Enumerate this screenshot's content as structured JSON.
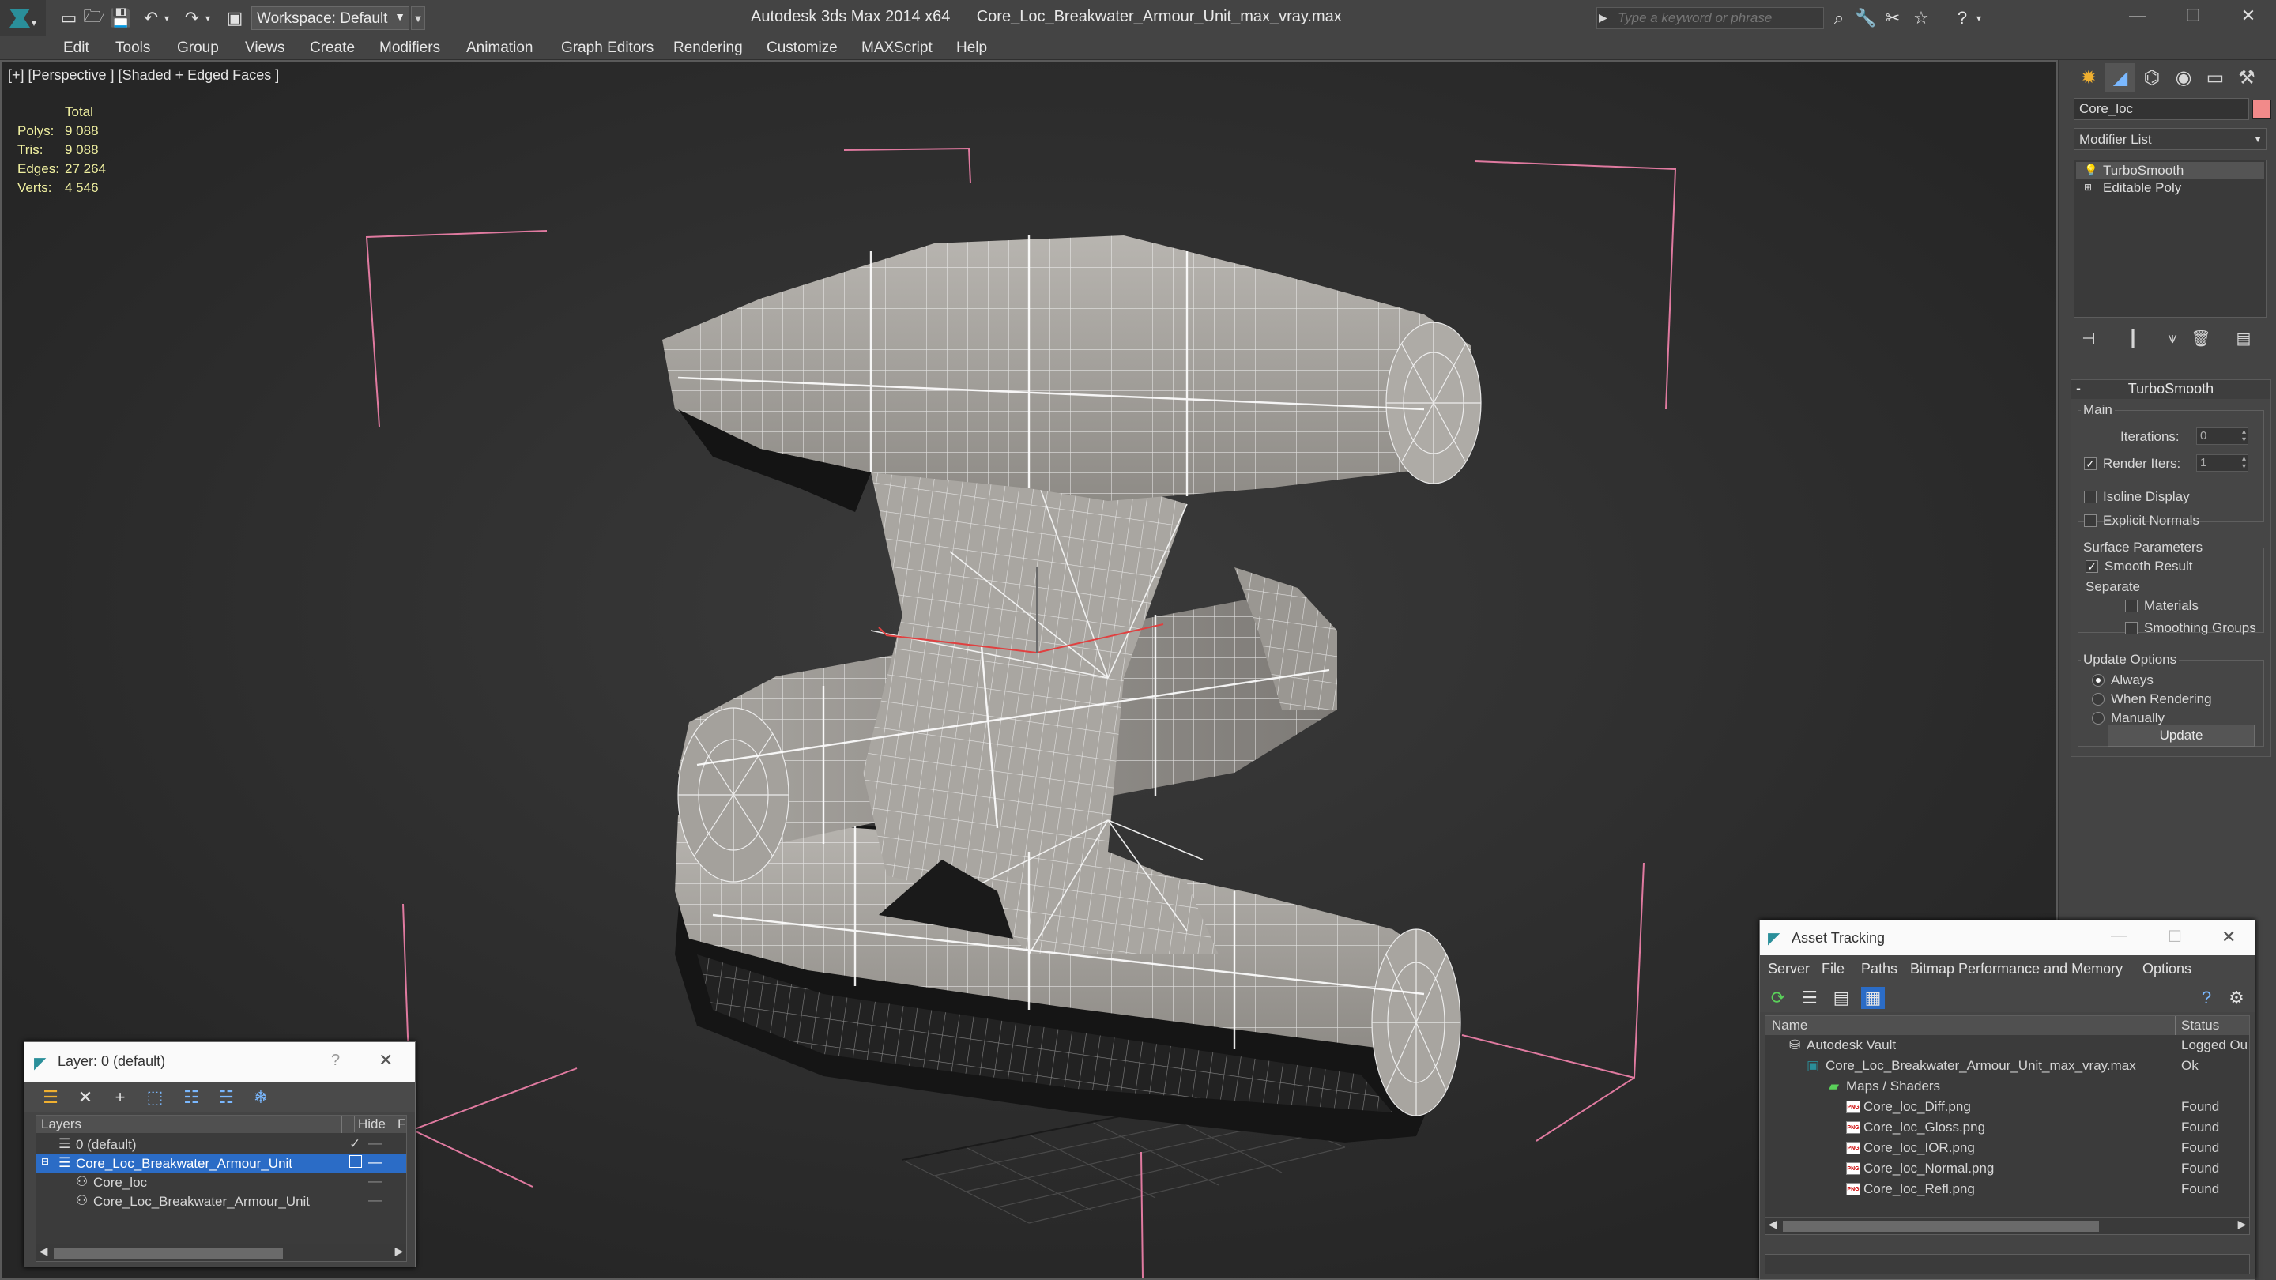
{
  "title_bar": {
    "title": "Autodesk 3ds Max 2014 x64      Core_Loc_Breakwater_Armour_Unit_max_vray.max",
    "workspace_label": "Workspace: Default",
    "search_placeholder": "Type a keyword or phrase"
  },
  "menu": [
    "Edit",
    "Tools",
    "Group",
    "Views",
    "Create",
    "Modifiers",
    "Animation",
    "Graph Editors",
    "Rendering",
    "Customize",
    "MAXScript",
    "Help"
  ],
  "viewport": {
    "label": "[+] [Perspective ] [Shaded + Edged Faces ]",
    "stats": {
      "header": "Total",
      "rows": [
        {
          "label": "Polys:",
          "value": "9 088"
        },
        {
          "label": "Tris:",
          "value": "9 088"
        },
        {
          "label": "Edges:",
          "value": "27 264"
        },
        {
          "label": "Verts:",
          "value": "4 546"
        }
      ]
    }
  },
  "command_panel": {
    "object_name": "Core_loc",
    "object_color": "#f28a8a",
    "modifier_list_label": "Modifier List",
    "stack": [
      "TurboSmooth",
      "Editable Poly"
    ],
    "turbosmooth": {
      "header": "TurboSmooth",
      "main_label": "Main",
      "iterations_label": "Iterations:",
      "iterations_value": "0",
      "render_iters_label": "Render Iters:",
      "render_iters_value": "1",
      "isoline_label": "Isoline Display",
      "explicit_label": "Explicit Normals",
      "surface_label": "Surface Parameters",
      "smooth_label": "Smooth Result",
      "separate_label": "Separate",
      "materials_label": "Materials",
      "smoothing_groups_label": "Smoothing Groups",
      "update_options_label": "Update Options",
      "always_label": "Always",
      "when_rendering_label": "When Rendering",
      "manually_label": "Manually",
      "update_button": "Update"
    }
  },
  "layer_dialog": {
    "title": "Layer: 0 (default)",
    "col_layers": "Layers",
    "col_hide": "Hide",
    "col_f": "F",
    "rows": [
      {
        "name": "0 (default)"
      },
      {
        "name": "Core_Loc_Breakwater_Armour_Unit"
      },
      {
        "name": "Core_loc"
      },
      {
        "name": "Core_Loc_Breakwater_Armour_Unit"
      }
    ]
  },
  "asset_tracking": {
    "title": "Asset Tracking",
    "menu": [
      "Server",
      "File",
      "Paths",
      "Bitmap Performance and Memory",
      "Options"
    ],
    "col_name": "Name",
    "col_status": "Status",
    "rows": [
      {
        "name": "Autodesk Vault",
        "status": "Logged Ou"
      },
      {
        "name": "Core_Loc_Breakwater_Armour_Unit_max_vray.max",
        "status": "Ok"
      },
      {
        "name": "Maps / Shaders",
        "status": ""
      },
      {
        "name": "Core_loc_Diff.png",
        "status": "Found"
      },
      {
        "name": "Core_loc_Gloss.png",
        "status": "Found"
      },
      {
        "name": "Core_loc_IOR.png",
        "status": "Found"
      },
      {
        "name": "Core_loc_Normal.png",
        "status": "Found"
      },
      {
        "name": "Core_loc_Refl.png",
        "status": "Found"
      }
    ]
  }
}
